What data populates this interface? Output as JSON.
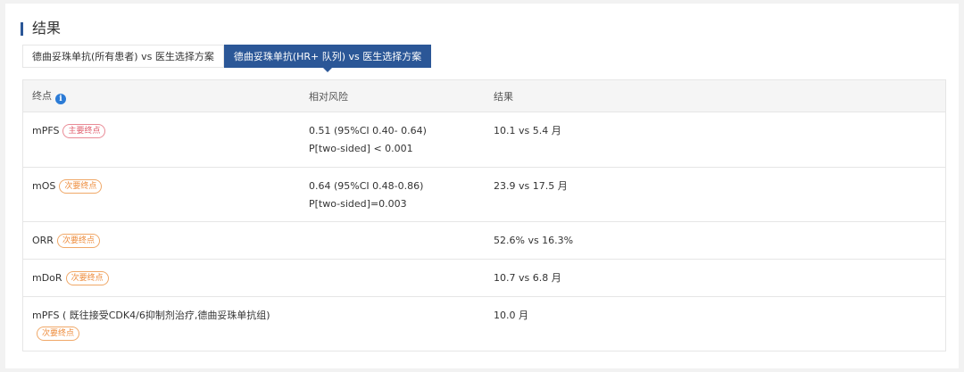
{
  "section": {
    "title": "结果"
  },
  "tabs": [
    {
      "label": "德曲妥珠单抗(所有患者) vs 医生选择方案",
      "active": false
    },
    {
      "label": "德曲妥珠单抗(HR+ 队列) vs 医生选择方案",
      "active": true
    }
  ],
  "table": {
    "headers": {
      "endpoint": "终点",
      "hazard_ratio": "相对风险",
      "result": "结果"
    },
    "info_icon": "info-icon",
    "rows": [
      {
        "endpoint": "mPFS",
        "badge": "主要终点",
        "hr_line1": "0.51 (95%CI 0.40- 0.64)",
        "hr_line2": "P[two-sided] < 0.001",
        "result": "10.1 vs 5.4 月"
      },
      {
        "endpoint": "mOS",
        "badge": "次要终点",
        "hr_line1": "0.64 (95%CI 0.48-0.86)",
        "hr_line2": "P[two-sided]=0.003",
        "result": "23.9 vs 17.5 月"
      },
      {
        "endpoint": "ORR",
        "badge": "次要终点",
        "hr_line1": "",
        "hr_line2": "",
        "result": "52.6% vs 16.3%"
      },
      {
        "endpoint": "mDoR",
        "badge": "次要终点",
        "hr_line1": "",
        "hr_line2": "",
        "result": "10.7 vs 6.8 月"
      },
      {
        "endpoint": "mPFS ( 既往接受CDK4/6抑制剂治疗,德曲妥珠单抗组)",
        "badge": "次要终点",
        "hr_line1": "",
        "hr_line2": "",
        "result": "10.0 月"
      }
    ]
  },
  "colors": {
    "accent": "#2b5797",
    "primary_badge": "#e05f6e",
    "secondary_badge": "#ee8c3c"
  }
}
